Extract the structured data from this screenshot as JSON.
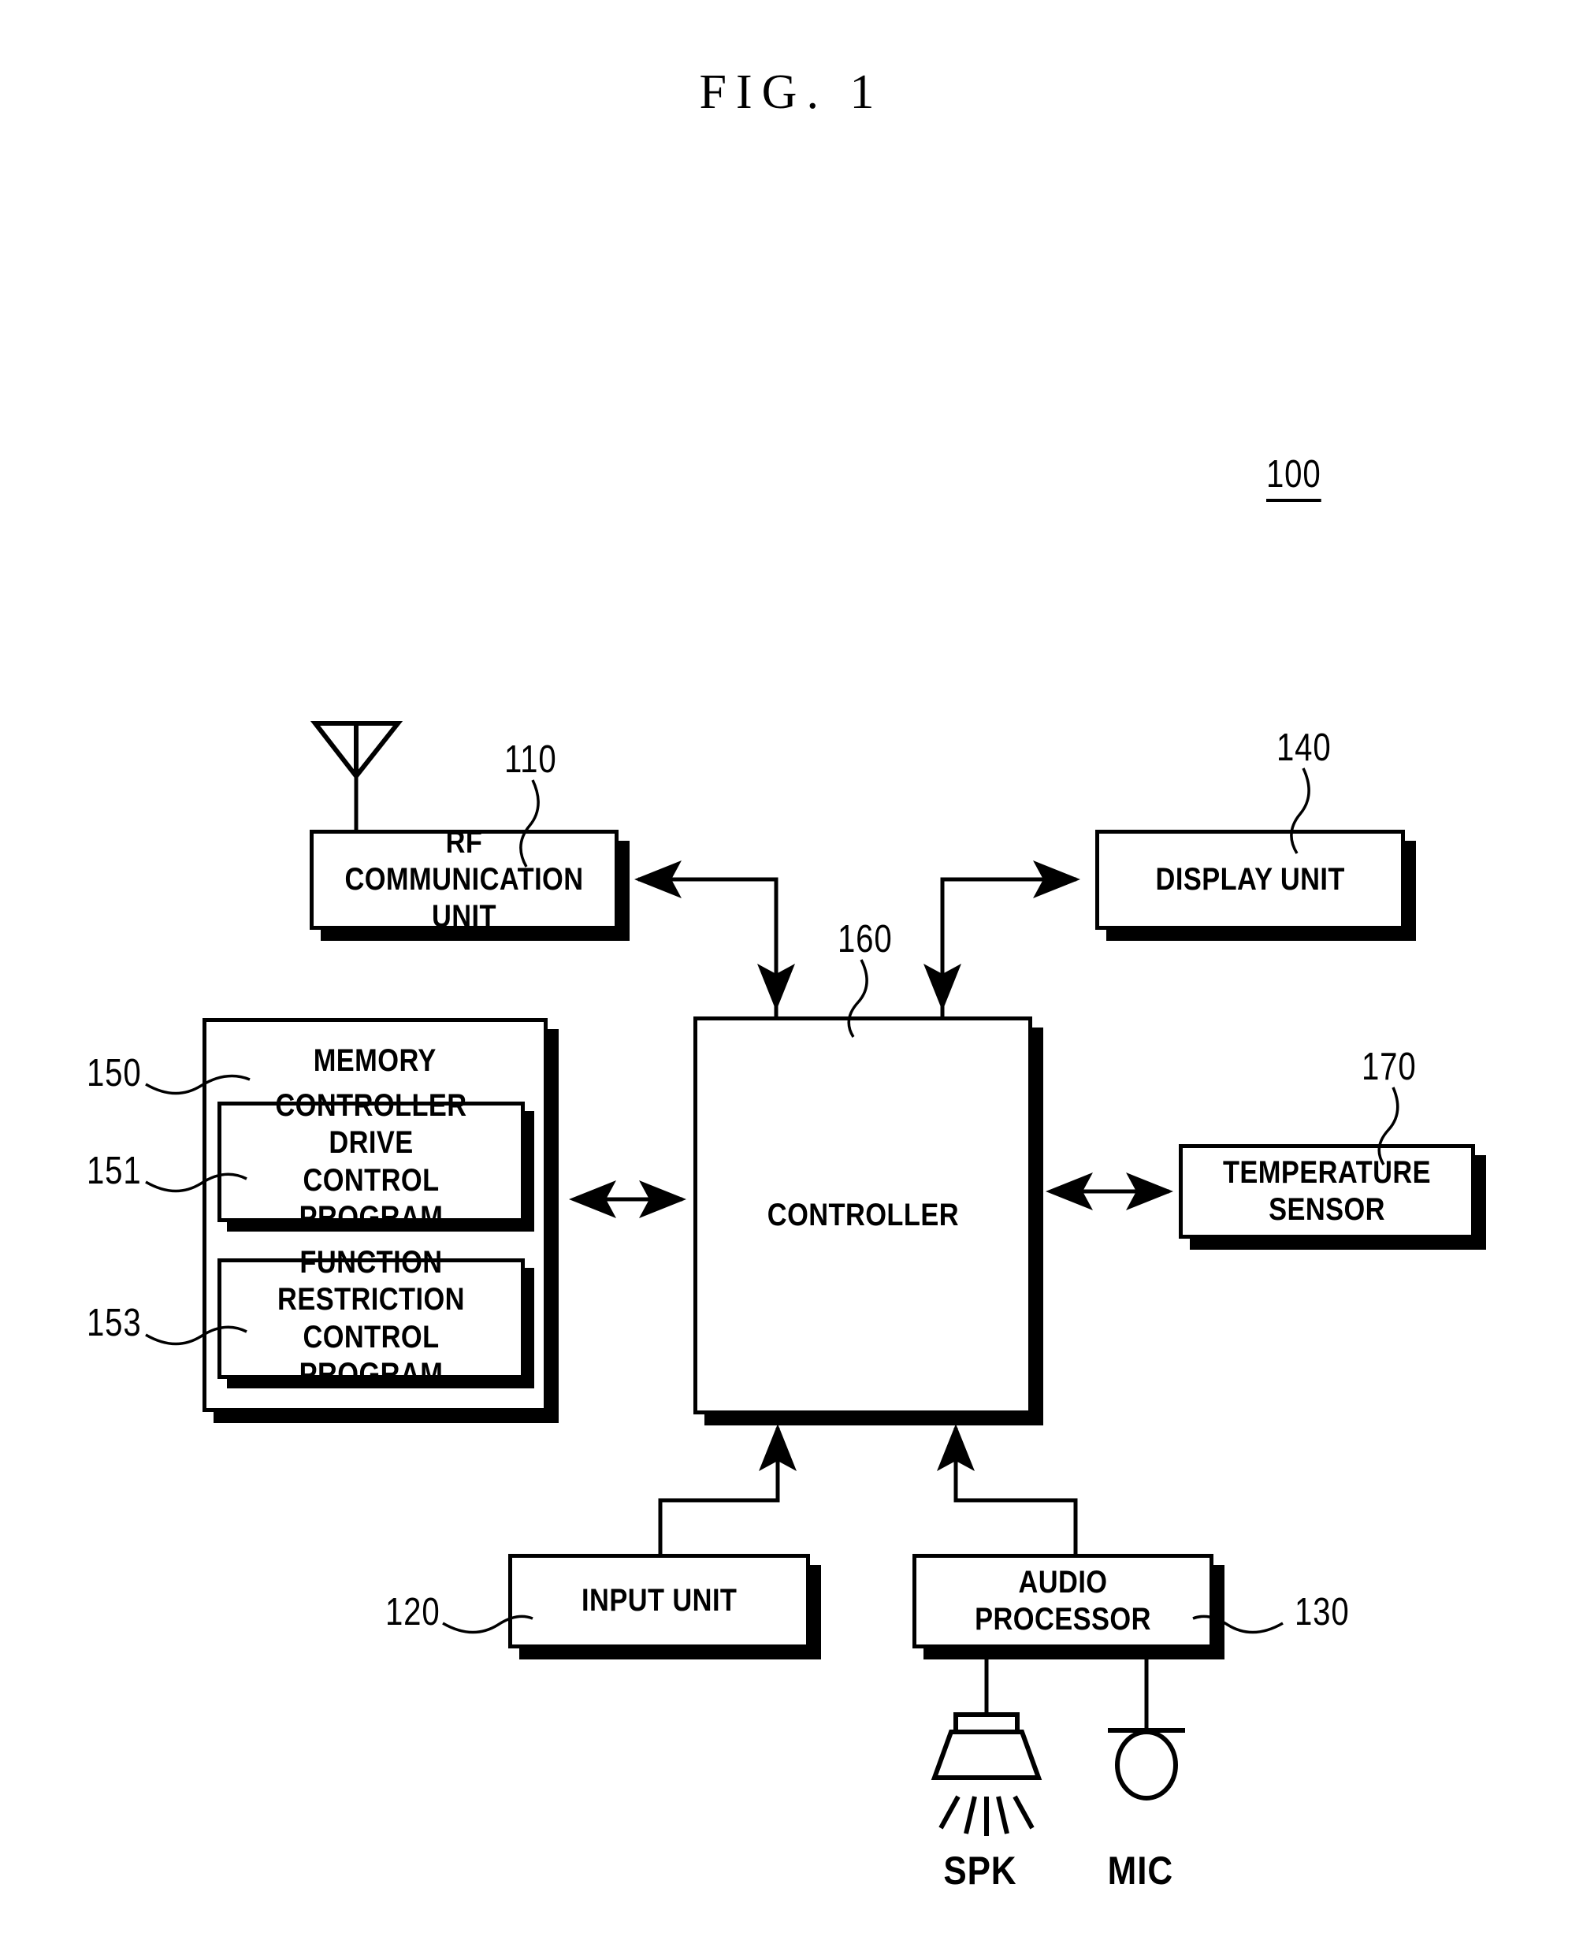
{
  "figure": {
    "title": "FIG. 1",
    "device_ref": "100"
  },
  "blocks": {
    "rf": {
      "label": "RF COMMUNICATION\nUNIT",
      "ref": "110"
    },
    "display": {
      "label": "DISPLAY UNIT",
      "ref": "140"
    },
    "memory": {
      "label": "MEMORY",
      "ref": "150"
    },
    "controller_drive_program": {
      "label": "CONTROLLER DRIVE\nCONTROL PROGRAM",
      "ref": "151"
    },
    "function_restriction_program": {
      "label": "FUNCTION RESTRICTION\nCONTROL PROGRAM",
      "ref": "153"
    },
    "controller": {
      "label": "CONTROLLER",
      "ref": "160"
    },
    "temperature_sensor": {
      "label": "TEMPERATURE SENSOR",
      "ref": "170"
    },
    "input": {
      "label": "INPUT UNIT",
      "ref": "120"
    },
    "audio": {
      "label": "AUDIO PROCESSOR",
      "ref": "130"
    }
  },
  "peripherals": {
    "speaker_label": "SPK",
    "microphone_label": "MIC",
    "antenna_label": "antenna"
  },
  "style": {
    "line_color": "#000000",
    "background": "#ffffff"
  }
}
